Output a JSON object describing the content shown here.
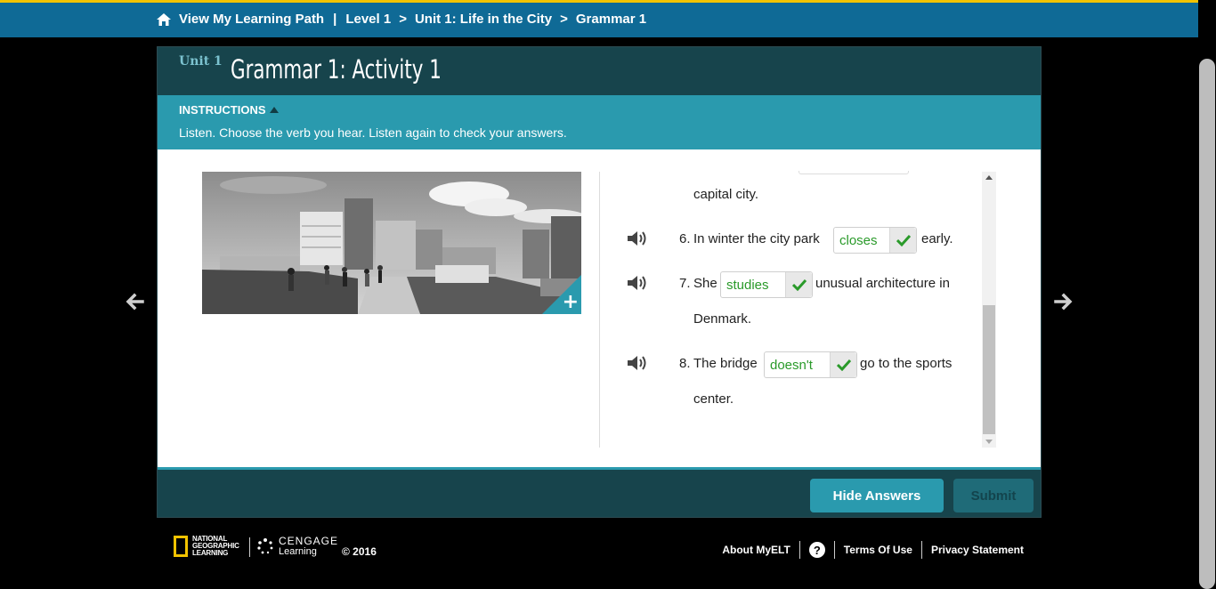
{
  "breadcrumb": {
    "home_label": "View My Learning Path",
    "separator": "|",
    "gt": ">",
    "level": "Level 1",
    "unit": "Unit 1: Life in the City",
    "lesson": "Grammar 1"
  },
  "header": {
    "unit_tag": "Unit 1",
    "title": "Grammar 1: Activity 1"
  },
  "instructions": {
    "label": "INSTRUCTIONS",
    "text": "Listen. Choose the verb you hear. Listen again to check your answers."
  },
  "questions": {
    "prev_tail": "capital city.",
    "items": [
      {
        "number": "6.",
        "before": "In winter the city park",
        "answer": "closes",
        "after": "early.",
        "continuation": ""
      },
      {
        "number": "7.",
        "before": "She",
        "answer": "studies",
        "after": "unusual architecture in",
        "continuation": "Denmark."
      },
      {
        "number": "8.",
        "before": "The bridge",
        "answer": "doesn't",
        "after": "go to the sports",
        "continuation": "center."
      }
    ]
  },
  "buttons": {
    "hide_answers": "Hide Answers",
    "submit": "Submit"
  },
  "footer": {
    "ng_logo": [
      "NATIONAL",
      "GEOGRAPHIC",
      "LEARNING"
    ],
    "cengage_logo": "CENGAGE",
    "cengage_sub": "Learning",
    "copyright": "© 2016",
    "about": "About MyELT",
    "help": "?",
    "terms": "Terms Of Use",
    "privacy": "Privacy Statement"
  },
  "colors": {
    "top_bar": "#0f6a96",
    "accent": "#2a9aae",
    "header_dark": "#17444c",
    "correct_green": "#2a9a2a",
    "yellow_border": "#f2c300"
  },
  "icons": [
    "home-icon",
    "speaker-icon",
    "check-icon",
    "arrow-left-icon",
    "arrow-right-icon",
    "plus-icon",
    "question-icon"
  ]
}
